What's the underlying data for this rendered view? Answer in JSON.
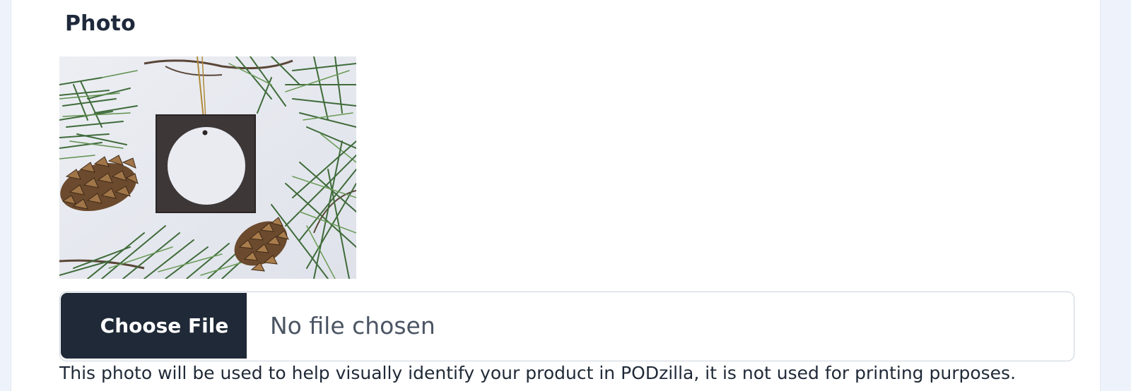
{
  "photo_field": {
    "title": "Photo",
    "preview_alt": "Product photo: blank square ornament with a white circle among pine branches and pine cones",
    "choose_button_label": "Choose File",
    "file_status": "No file chosen",
    "helper_text": "This photo will be used to help visually identify your product in PODzilla, it is not used for printing purposes."
  },
  "colors": {
    "page_background": "#eef2fb",
    "button_background": "#1f2937",
    "button_text": "#ffffff",
    "title_text": "#1e293b"
  }
}
